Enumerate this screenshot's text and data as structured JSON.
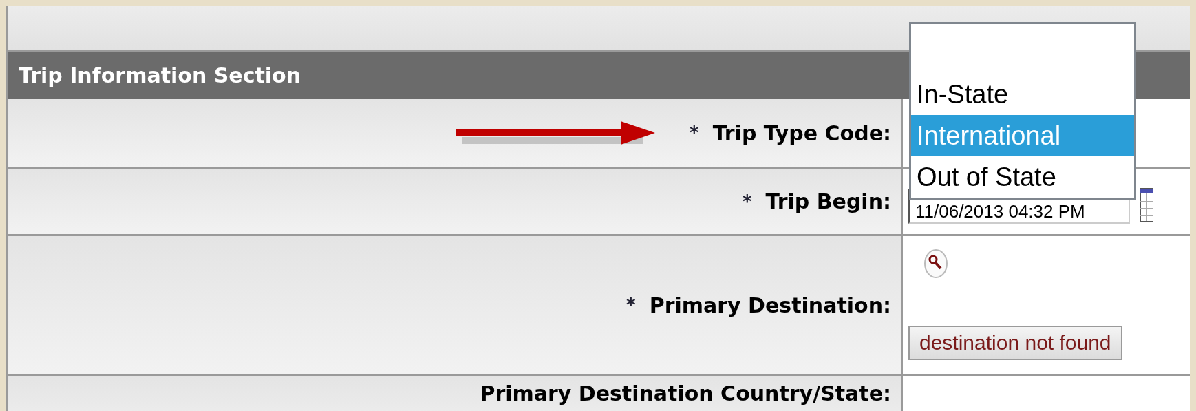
{
  "section": {
    "title": "Trip Information Section"
  },
  "fields": [
    {
      "kind": "select",
      "required_mark": "*",
      "label": "Trip Type Code:",
      "pointed": true
    },
    {
      "kind": "datetime",
      "required_mark": "*",
      "label": "Trip Begin:",
      "value": "11/06/2013 04:32 PM",
      "pointed": false
    },
    {
      "kind": "lookup",
      "required_mark": "*",
      "label": "Primary Destination:",
      "button": "destination not found",
      "pointed": false
    },
    {
      "kind": "text",
      "label": "Primary Destination Country/State:",
      "pointed": false
    }
  ],
  "dropdown": {
    "options": [
      {
        "label": "In-State",
        "selected": false
      },
      {
        "label": "International",
        "selected": true
      },
      {
        "label": "Out of State",
        "selected": false
      }
    ]
  }
}
